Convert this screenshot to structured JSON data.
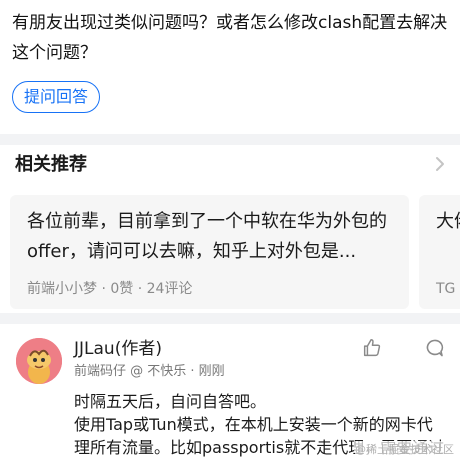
{
  "question": {
    "text": "有朋友出现过类似问题吗？或者怎么修改clash配置去解决这个问题？",
    "ask_button": "提问回答"
  },
  "related": {
    "title": "相关推荐",
    "cards": [
      {
        "title": "各位前辈，目前拿到了一个中软在华为外包的offer，请问可以去嘛，知乎上对外包是...",
        "meta": "前端小小梦 · 0赞 · 24评论"
      },
      {
        "title": "大佬了...",
        "meta": "TG"
      }
    ]
  },
  "answer": {
    "author": "JJLau(作者)",
    "subtitle": "前端码仔 @ 不快乐 · 刚刚",
    "lines": [
      "时隔五天后，自问自答吧。",
      "使用Tap或Tun模式，在本机上安装一个新的网卡代",
      "理所有流量。比如passportis就不走代理，需要通过"
    ]
  },
  "watermark": "@稀土掘金技术社区",
  "colors": {
    "accent": "#1772f6",
    "avatar_bg": "#ee7e86"
  }
}
